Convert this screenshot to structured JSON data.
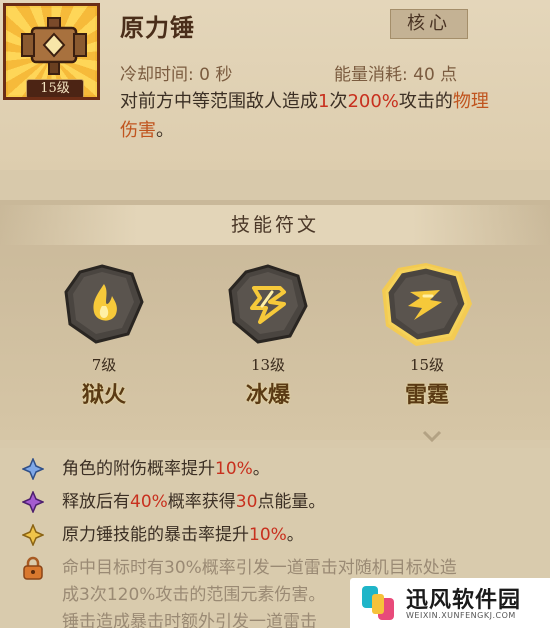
{
  "skill": {
    "name": "原力锤",
    "level": "15级",
    "tag": "核心",
    "cooldown": "冷却时间: 0 秒",
    "energy": "能量消耗: 40 点",
    "description": {
      "part1": "对前方中等范围敌人造成",
      "hits": "1",
      "part2": "次",
      "percent": "200%",
      "part3": "攻击的",
      "damage_type": "物理伤害",
      "part4": "。"
    }
  },
  "runes": {
    "title": "技能符文",
    "items": [
      {
        "name": "狱火",
        "level": "7级",
        "icon": "flame-rune-icon",
        "selected": false
      },
      {
        "name": "冰爆",
        "level": "13级",
        "icon": "ice-burst-rune-icon",
        "selected": false
      },
      {
        "name": "雷霆",
        "level": "15级",
        "icon": "thunder-rune-icon",
        "selected": true
      }
    ]
  },
  "effects": [
    {
      "gem": "blue",
      "a": "角色的附伤概率提升",
      "b": "10%",
      "c": "。"
    },
    {
      "gem": "purple",
      "a": "释放后有",
      "b": "40%",
      "c": "概率获得",
      "d": "30",
      "e": "点能量。"
    },
    {
      "gem": "yellow",
      "a": "原力锤技能的暴击率提升",
      "b": "10%",
      "c": "。"
    }
  ],
  "locked_effect": {
    "line1": "命中目标时有30%概率引发一道雷击对随机目标处造",
    "line2": "成3次120%攻击的范围元素伤害。",
    "line3": "锤击造成暴击时额外引发一道雷击"
  },
  "watermark": {
    "title": "迅风软件园",
    "url": "WEIXIN.XUNFENGKJ.COM"
  },
  "colors": {
    "highlight_red": "#c8301e",
    "damage_orange": "#c0541e",
    "gem_blue": "#4a78c4",
    "gem_purple": "#8b3fb5",
    "gem_yellow": "#d9a62e",
    "selected_glow": "#ffcf3a"
  }
}
